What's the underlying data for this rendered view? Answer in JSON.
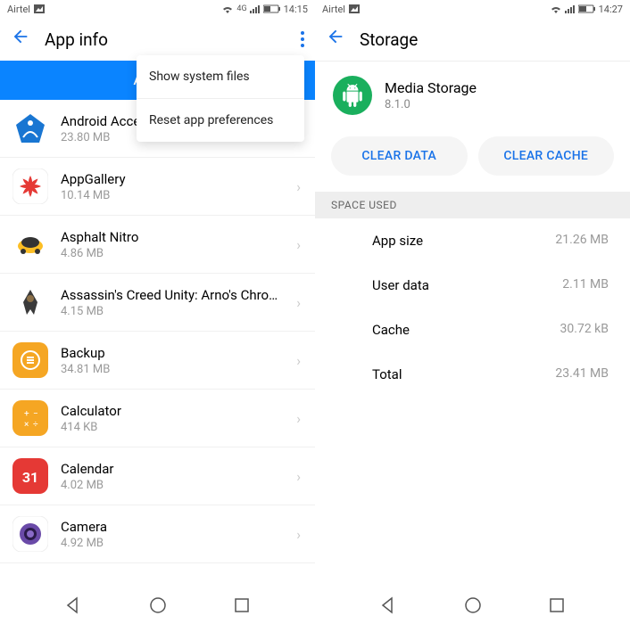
{
  "left": {
    "status": {
      "carrier": "Airtel",
      "time": "14:15"
    },
    "title": "App info",
    "tab_label": "All apps",
    "popup": {
      "items": [
        {
          "label": "Show system files"
        },
        {
          "label": "Reset app preferences"
        }
      ]
    },
    "apps": [
      {
        "name": "Android Acce...",
        "size": "23.80 MB",
        "icon_bg": "#1976d2",
        "icon_shape": "pentagon"
      },
      {
        "name": "AppGallery",
        "size": "10.14 MB",
        "icon_bg": "#ffffff",
        "icon_shape": "huawei"
      },
      {
        "name": "Asphalt Nitro",
        "size": "4.86 MB",
        "icon_bg": "#fcbe24",
        "icon_shape": "car"
      },
      {
        "name": "Assassin's Creed Unity: Arno's Chroni..",
        "size": "4.15 MB",
        "icon_bg": "#ffffff",
        "icon_shape": "assassin"
      },
      {
        "name": "Backup",
        "size": "34.81 MB",
        "icon_bg": "#f5a623",
        "icon_shape": "backup"
      },
      {
        "name": "Calculator",
        "size": "414 KB",
        "icon_bg": "#f5a623",
        "icon_shape": "calc"
      },
      {
        "name": "Calendar",
        "size": "4.02 MB",
        "icon_bg": "#e53935",
        "icon_shape": "calendar"
      },
      {
        "name": "Camera",
        "size": "4.92 MB",
        "icon_bg": "#ffffff",
        "icon_shape": "camera"
      }
    ]
  },
  "right": {
    "status": {
      "carrier": "Airtel",
      "time": "14:27"
    },
    "title": "Storage",
    "app": {
      "name": "Media Storage",
      "version": "8.1.0"
    },
    "actions": {
      "clear_data": "CLEAR DATA",
      "clear_cache": "CLEAR CACHE"
    },
    "section_label": "SPACE USED",
    "rows": [
      {
        "label": "App size",
        "value": "21.26 MB"
      },
      {
        "label": "User data",
        "value": "2.11 MB"
      },
      {
        "label": "Cache",
        "value": "30.72 kB"
      },
      {
        "label": "Total",
        "value": "23.41 MB"
      }
    ]
  }
}
